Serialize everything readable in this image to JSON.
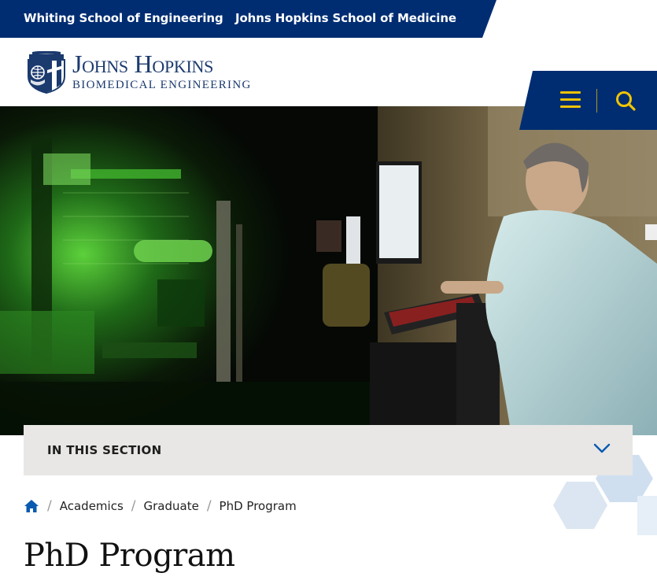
{
  "utility": {
    "links": [
      "Whiting School of Engineering",
      "Johns Hopkins School of Medicine"
    ]
  },
  "logo": {
    "name_first": "Johns",
    "name_second": "Hopkins",
    "department": "BIOMEDICAL ENGINEERING"
  },
  "header": {
    "menu_icon": "hamburger-icon",
    "search_icon": "search-icon"
  },
  "hero": {
    "image": "researcher-at-green-laser-microscope-photo"
  },
  "section_nav": {
    "label": "IN THIS SECTION",
    "icon": "chevron-down-icon"
  },
  "breadcrumb": {
    "home_icon": "home-icon",
    "items": [
      "Academics",
      "Graduate",
      "PhD Program"
    ]
  },
  "page": {
    "title": "PhD Program"
  },
  "colors": {
    "brand_blue": "#002d72",
    "accent_gold": "#f1c400",
    "link_blue": "#0a5ab0",
    "section_bar_bg": "#e8e7e5"
  }
}
